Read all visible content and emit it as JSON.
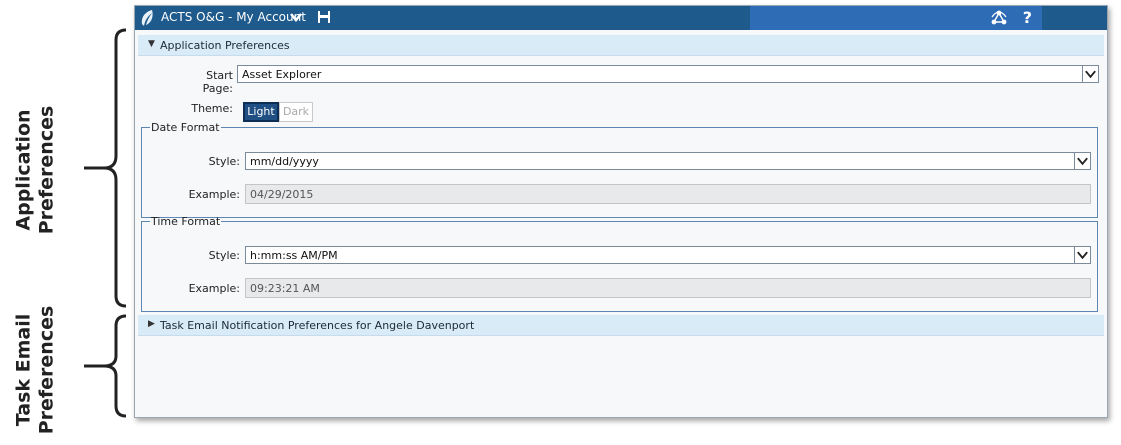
{
  "annotations": {
    "app_preferences": [
      "Application",
      "Preferences"
    ],
    "task_email_preferences": [
      "Task Email",
      "Preferences"
    ]
  },
  "titlebar": {
    "title": "ACTS O&G - My Account",
    "help_label": "?",
    "colors": {
      "bar": "#1f5a8c",
      "bar_right": "#2f6cb6"
    }
  },
  "app_prefs": {
    "header": "Application Preferences",
    "start_page": {
      "label": "Start Page:",
      "value": "Asset Explorer"
    },
    "theme": {
      "label": "Theme:",
      "options": [
        "Light",
        "Dark"
      ],
      "selected": "Light"
    },
    "date_format": {
      "legend": "Date Format",
      "style_label": "Style:",
      "style_value": "mm/dd/yyyy",
      "example_label": "Example:",
      "example_value": "04/29/2015"
    },
    "time_format": {
      "legend": "Time Format",
      "style_label": "Style:",
      "style_value": "h:mm:ss AM/PM",
      "example_label": "Example:",
      "example_value": "09:23:21 AM"
    }
  },
  "task_email": {
    "header": "Task Email Notification Preferences for Angele Davenport"
  },
  "icons": [
    "app-leaf-icon",
    "chevron-down-icon",
    "save-icon",
    "network-icon",
    "help-icon",
    "expand-triangle-icon",
    "collapse-triangle-icon"
  ]
}
